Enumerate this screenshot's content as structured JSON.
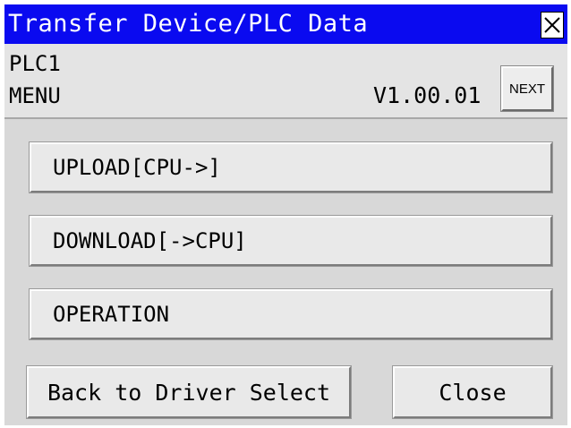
{
  "window": {
    "title": "Transfer Device/PLC Data",
    "close_icon": "close-x-icon"
  },
  "info": {
    "plc": "PLC1",
    "menu": "MENU",
    "version": "V1.00.01",
    "next_label": "NEXT"
  },
  "buttons": {
    "upload": "UPLOAD[CPU->]",
    "download": "DOWNLOAD[->CPU]",
    "operation": "OPERATION",
    "back": "Back to Driver Select",
    "close": "Close"
  },
  "colors": {
    "titlebar": "#0a0af0",
    "panel": "#d8d8d8"
  }
}
